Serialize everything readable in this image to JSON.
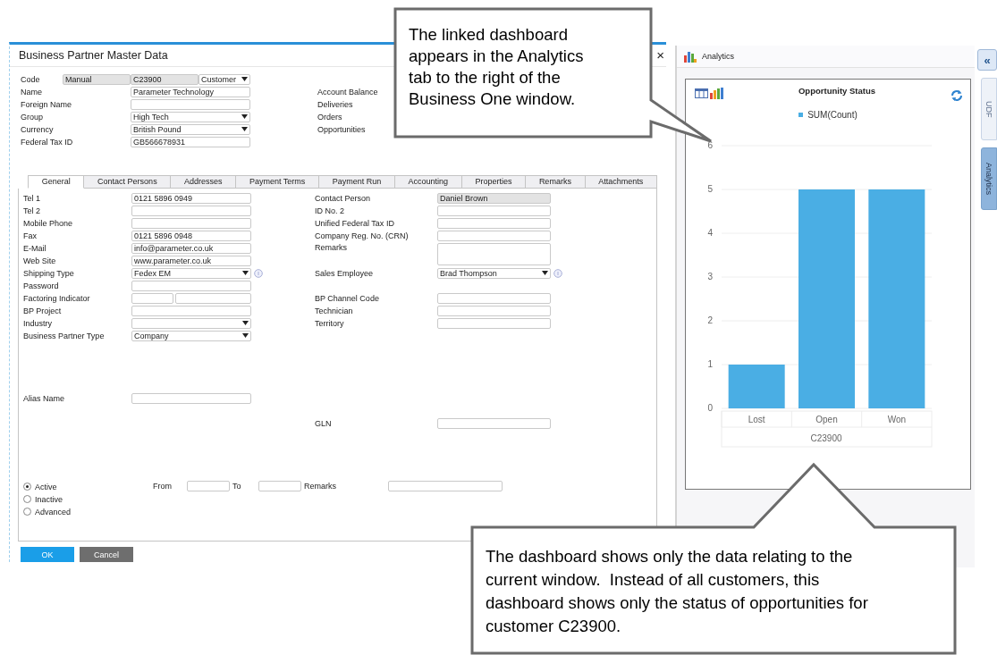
{
  "window": {
    "title": "Business Partner Master Data",
    "close": "×"
  },
  "header": {
    "code": {
      "label": "Code",
      "parts": [
        {
          "value": "Manual",
          "kind": "readonly"
        },
        {
          "value": "C23900",
          "kind": "readonly"
        },
        {
          "value": "Customer",
          "kind": "dropdown"
        }
      ]
    },
    "fields": [
      {
        "label": "Name",
        "value": "Parameter Technology",
        "kind": "text"
      },
      {
        "label": "Foreign Name",
        "kind": "text"
      },
      {
        "label": "Group",
        "value": "High Tech",
        "kind": "dropdown",
        "info": false
      },
      {
        "label": "Currency",
        "value": "British Pound",
        "kind": "dropdown",
        "info": false
      },
      {
        "label": "Federal Tax ID",
        "value": "GB566678931",
        "kind": "text"
      }
    ],
    "summary_labels": [
      "Account Balance",
      "Deliveries",
      "Orders",
      "Opportunities"
    ]
  },
  "tabs": [
    {
      "label": "General",
      "selected": true
    },
    {
      "label": "Contact Persons",
      "selected": false
    },
    {
      "label": "Addresses",
      "selected": false
    },
    {
      "label": "Payment Terms",
      "selected": false
    },
    {
      "label": "Payment Run",
      "selected": false
    },
    {
      "label": "Accounting",
      "selected": false
    },
    {
      "label": "Properties",
      "selected": false
    },
    {
      "label": "Remarks",
      "selected": false
    },
    {
      "label": "Attachments",
      "selected": false
    }
  ],
  "general": {
    "left": [
      {
        "label": "Tel 1",
        "value": "0121 5896 0949",
        "kind": "text"
      },
      {
        "label": "Tel 2",
        "kind": "text"
      },
      {
        "label": "Mobile Phone",
        "kind": "text"
      },
      {
        "label": "Fax",
        "value": "0121 5896 0948",
        "kind": "text"
      },
      {
        "label": "E-Mail",
        "value": "info@parameter.co.uk",
        "kind": "text"
      },
      {
        "label": "Web Site",
        "value": "www.parameter.co.uk",
        "kind": "text"
      },
      {
        "label": "Shipping Type",
        "value": "Fedex EM",
        "kind": "dropdown",
        "info": true
      },
      {
        "label": "Password",
        "kind": "text"
      },
      {
        "label": "Factoring Indicator",
        "kind": "split"
      },
      {
        "label": "BP Project",
        "kind": "text"
      },
      {
        "label": "Industry",
        "kind": "dropdown",
        "info": false
      },
      {
        "label": "Business Partner Type",
        "value": "Company",
        "kind": "dropdown",
        "info": false
      }
    ],
    "right_upper": [
      {
        "label": "Contact Person",
        "value": "Daniel Brown",
        "kind": "readonly"
      },
      {
        "label": "ID No. 2",
        "kind": "text"
      },
      {
        "label": "Unified Federal Tax ID",
        "kind": "text"
      },
      {
        "label": "Company Reg. No. (CRN)",
        "kind": "text"
      },
      {
        "label": "Remarks",
        "kind": "memo"
      },
      {
        "label": "Sales Employee",
        "value": "Brad Thompson",
        "kind": "dropdown",
        "info": true
      }
    ],
    "right_lower": [
      {
        "label": "BP Channel Code",
        "kind": "text"
      },
      {
        "label": "Technician",
        "kind": "text"
      },
      {
        "label": "Territory",
        "kind": "text"
      }
    ],
    "alias": {
      "label": "Alias Name",
      "kind": "text"
    },
    "gln": {
      "label": "GLN",
      "kind": "text"
    }
  },
  "status": {
    "options": [
      {
        "label": "Active",
        "selected": true
      },
      {
        "label": "Inactive",
        "selected": false
      },
      {
        "label": "Advanced",
        "selected": false
      }
    ],
    "from": "From",
    "to": "To",
    "remarks": "Remarks"
  },
  "buttons": [
    {
      "label": "OK",
      "kind": "primary"
    },
    {
      "label": "Cancel",
      "kind": "secondary"
    }
  ],
  "analytics": {
    "title": "Analytics",
    "card": {
      "chart_data": {
        "type": "bar",
        "title": "Opportunity Status",
        "xlabel": "C23900",
        "categories": [
          "Lost",
          "Open",
          "Won"
        ],
        "series": [
          {
            "name": "SUM(Count)",
            "color": "#4aaee4",
            "values": [
              1,
              5,
              5
            ]
          }
        ],
        "ylim": [
          0,
          6
        ],
        "yticks": [
          0,
          1,
          2,
          3,
          4,
          5,
          6
        ],
        "grid": true
      }
    }
  },
  "side": {
    "collapse": "«",
    "tabs": [
      {
        "label": "UDF",
        "selected": false
      },
      {
        "label": "Analytics",
        "selected": true
      }
    ]
  },
  "callouts": [
    {
      "text": "The linked dashboard appears in the Analytics tab to the right of the Business One window."
    },
    {
      "text": "The dashboard shows only the data relating to the current window.  Instead of all customers, this dashboard shows only the status of opportunities for customer C23900."
    }
  ]
}
